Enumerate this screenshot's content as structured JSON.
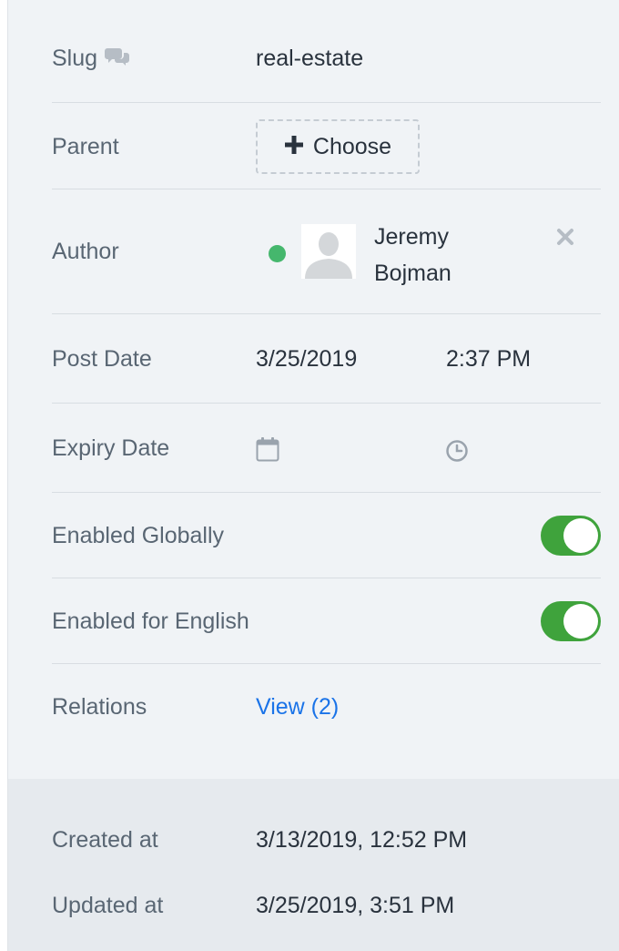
{
  "fields": {
    "slug": {
      "label": "Slug",
      "value": "real-estate"
    },
    "parent": {
      "label": "Parent",
      "button_label": "Choose"
    },
    "author": {
      "label": "Author",
      "first_name": "Jeremy",
      "last_name": "Bojman",
      "status_color": "#27ab55"
    },
    "post_date": {
      "label": "Post Date",
      "date": "3/25/2019",
      "time": "2:37 PM"
    },
    "expiry_date": {
      "label": "Expiry Date",
      "date": "",
      "time": ""
    },
    "enabled_globally": {
      "label": "Enabled Globally",
      "on": true
    },
    "enabled_english": {
      "label": "Enabled for English",
      "on": true
    },
    "relations": {
      "label": "Relations",
      "link_label": "View (2)"
    }
  },
  "meta": {
    "created": {
      "label": "Created at",
      "value": "3/13/2019, 12:52 PM"
    },
    "updated": {
      "label": "Updated at",
      "value": "3/25/2019, 3:51 PM"
    }
  },
  "colors": {
    "toggle_on": "#3fa33c",
    "link": "#1a73e8",
    "panel_bg": "#f0f3f6",
    "meta_bg": "#e6eaee"
  },
  "icons": {
    "slug_hint": "chat-bubbles-icon",
    "add": "plus-icon",
    "avatar": "user-placeholder-icon",
    "remove": "close-x-icon",
    "date": "calendar-icon",
    "time": "clock-icon"
  }
}
